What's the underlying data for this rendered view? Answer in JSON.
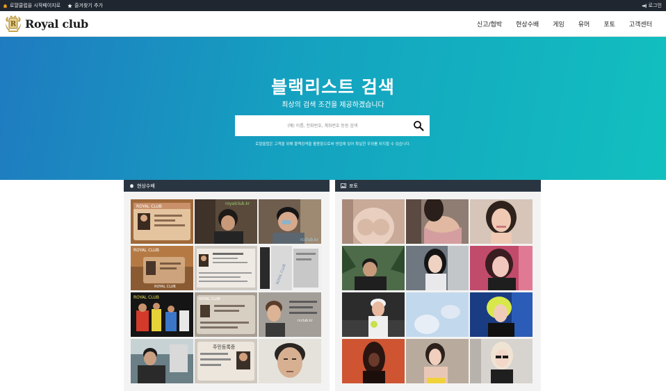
{
  "topbar": {
    "start_label": "로얄클럽을 시작페이지로",
    "bookmark_label": "즐겨찾기 추가",
    "login_label": "로그인"
  },
  "header": {
    "logo_text": "Royal club",
    "menu": [
      "신고/협박",
      "현상수배",
      "게임",
      "유머",
      "포토",
      "고객센터"
    ]
  },
  "hero": {
    "title": "블랙리스트 검색",
    "subtitle": "최상의 검색 조건을 제공하겠습니다",
    "search_placeholder": "(예) 이름, 전화번호, 계좌번호 등등 검색",
    "note": "로얄클럽은 고객을 위해 블랙검색을 활용함으로써 영업에 있어 확실한 우위를 차지할 수 있습니다."
  },
  "panels": {
    "wanted": {
      "title": "현상수배",
      "items": [
        {
          "label": "ROYAL CLUB"
        },
        {
          "label": "royalclub.kr"
        },
        {
          "label": "rcclub.kr"
        },
        {
          "label": "ROYAL CLUB"
        },
        {
          "label": ""
        },
        {
          "label": "ROYAL CLUB"
        },
        {
          "label": "ROYAL CLUB"
        },
        {
          "label": "ROYAL CLUB"
        },
        {
          "label": "rcclub.kr"
        },
        {
          "label": ""
        },
        {
          "label": "주민등록증"
        },
        {
          "label": ""
        }
      ]
    },
    "photo": {
      "title": "포토",
      "item_count": 12
    }
  },
  "colors": {
    "topbar_bg": "#1f2630",
    "panel_head_bg": "#2a3542",
    "hero_gradient_start": "#1f7bc0",
    "hero_gradient_end": "#12c0bf"
  },
  "icons": {
    "topbar_start": "home-icon",
    "topbar_bookmark": "star-icon",
    "topbar_login": "login-icon",
    "search": "search-icon",
    "wanted_panel": "hand-icon",
    "photo_panel": "image-icon"
  }
}
